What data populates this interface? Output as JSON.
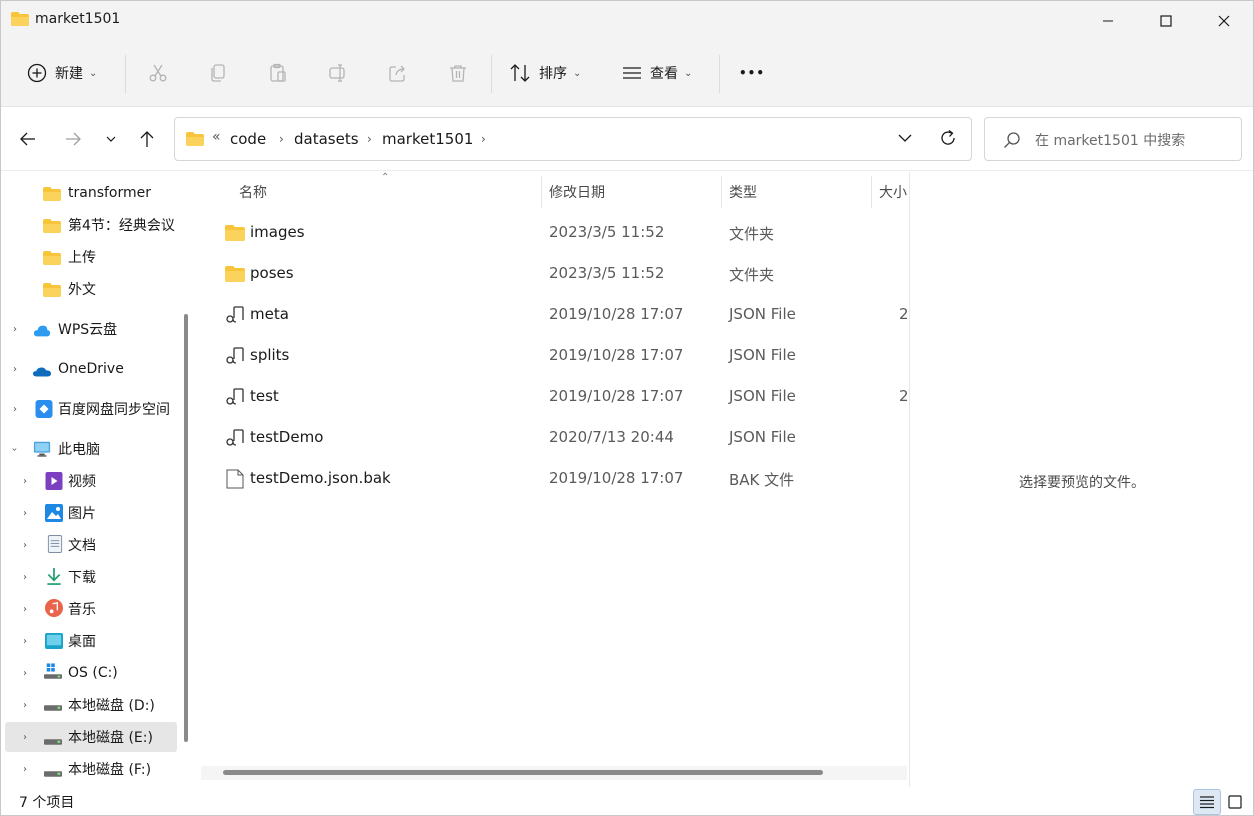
{
  "window": {
    "title": "market1501"
  },
  "toolbar": {
    "new_label": "新建",
    "sort_label": "排序",
    "view_label": "查看",
    "more_label": "•••"
  },
  "address": {
    "overflow": "«",
    "crumbs": [
      "code",
      "datasets",
      "market1501"
    ],
    "search_placeholder": "在 market1501 中搜索"
  },
  "sidebar": {
    "items": [
      {
        "label": "transformer",
        "icon": "folder-icon"
      },
      {
        "label": "第4节：经典会议",
        "icon": "folder-icon"
      },
      {
        "label": "上传",
        "icon": "folder-icon"
      },
      {
        "label": "外文",
        "icon": "folder-icon"
      },
      {
        "label": "WPS云盘",
        "icon": "cloud-icon"
      },
      {
        "label": "OneDrive",
        "icon": "onedrive-icon"
      },
      {
        "label": "百度网盘同步空间",
        "icon": "baidu-icon"
      },
      {
        "label": "此电脑",
        "icon": "computer-icon"
      },
      {
        "label": "视频",
        "icon": "video-icon"
      },
      {
        "label": "图片",
        "icon": "pictures-icon"
      },
      {
        "label": "文档",
        "icon": "documents-icon"
      },
      {
        "label": "下载",
        "icon": "download-icon"
      },
      {
        "label": "音乐",
        "icon": "music-icon"
      },
      {
        "label": "桌面",
        "icon": "desktop-icon"
      },
      {
        "label": "OS (C:)",
        "icon": "windows-drive-icon"
      },
      {
        "label": "本地磁盘 (D:)",
        "icon": "drive-icon"
      },
      {
        "label": "本地磁盘 (E:)",
        "icon": "drive-icon"
      },
      {
        "label": "本地磁盘 (F:)",
        "icon": "drive-icon"
      }
    ]
  },
  "filelist": {
    "columns": {
      "name": "名称",
      "date": "修改日期",
      "type": "类型",
      "size": "大小"
    },
    "rows": [
      {
        "name": "images",
        "date": "2023/3/5 11:52",
        "type": "文件夹",
        "size": "",
        "icon": "folder-icon"
      },
      {
        "name": "poses",
        "date": "2023/3/5 11:52",
        "type": "文件夹",
        "size": "",
        "icon": "folder-icon"
      },
      {
        "name": "meta",
        "date": "2019/10/28 17:07",
        "type": "JSON File",
        "size": "2",
        "icon": "json-file-icon"
      },
      {
        "name": "splits",
        "date": "2019/10/28 17:07",
        "type": "JSON File",
        "size": "",
        "icon": "json-file-icon"
      },
      {
        "name": "test",
        "date": "2019/10/28 17:07",
        "type": "JSON File",
        "size": "2",
        "icon": "json-file-icon"
      },
      {
        "name": "testDemo",
        "date": "2020/7/13 20:44",
        "type": "JSON File",
        "size": "",
        "icon": "json-file-icon"
      },
      {
        "name": "testDemo.json.bak",
        "date": "2019/10/28 17:07",
        "type": "BAK 文件",
        "size": "",
        "icon": "file-icon"
      }
    ]
  },
  "preview": {
    "message": "选择要预览的文件。"
  },
  "status": {
    "item_count": "7 个项目"
  }
}
